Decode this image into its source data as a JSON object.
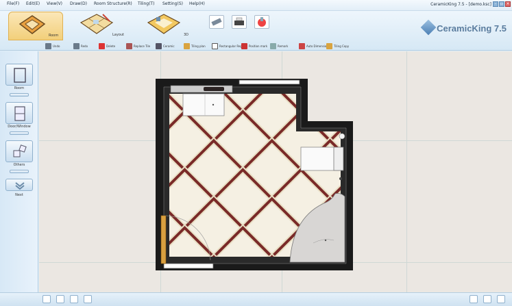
{
  "menu": {
    "items": [
      "File(F)",
      "Edit(E)",
      "View(V)",
      "Draw(D)",
      "Room Structure(R)",
      "Tiling(T)",
      "Setting(S)",
      "Help(H)"
    ],
    "window_title": "CeramicKing 7.5 - [demo.ksc]"
  },
  "ribbon": {
    "tabs": [
      {
        "label": "Room",
        "icon": "room-plan-icon"
      },
      {
        "label": "Layout",
        "icon": "layout-tile-icon"
      },
      {
        "label": "3D",
        "icon": "3d-view-icon"
      }
    ],
    "tools": [
      {
        "icon": "measure-tool-icon"
      },
      {
        "icon": "print-icon"
      },
      {
        "icon": "render-icon"
      }
    ],
    "logo": "CeramicKing 7.5",
    "subtools": [
      {
        "label": "Undo",
        "icon": "undo-icon"
      },
      {
        "label": "Redo",
        "icon": "redo-icon"
      },
      {
        "label": "Delete",
        "icon": "delete-icon"
      },
      {
        "label": "Replace Tile",
        "icon": "replace-tile-icon"
      },
      {
        "label": "Ceramic",
        "icon": "ceramic-icon"
      },
      {
        "label": "Tiling plan",
        "icon": "tiling-plan-icon"
      },
      {
        "label": "Rectangular Region",
        "icon": "rectangular-region-icon"
      },
      {
        "label": "Position mark",
        "icon": "position-mark-icon"
      },
      {
        "label": "Remark",
        "icon": "remark-icon"
      },
      {
        "label": "Auto Dimension",
        "icon": "auto-dimension-icon"
      },
      {
        "label": "Tiling Copy",
        "icon": "tiling-copy-icon"
      }
    ]
  },
  "left_panel": {
    "items": [
      {
        "label": "Room",
        "icon": "room-icon"
      },
      {
        "label": "Door/Window",
        "icon": "door-window-icon"
      },
      {
        "label": "Others",
        "icon": "others-icon"
      },
      {
        "label": "Next",
        "icon": "next-chevron-icon"
      }
    ]
  },
  "colors": {
    "tile_border": "#7a2a28",
    "tile_light": "#f5f0e3",
    "tile_beige": "#e8dfc4",
    "wall": "#1a1a1a"
  }
}
